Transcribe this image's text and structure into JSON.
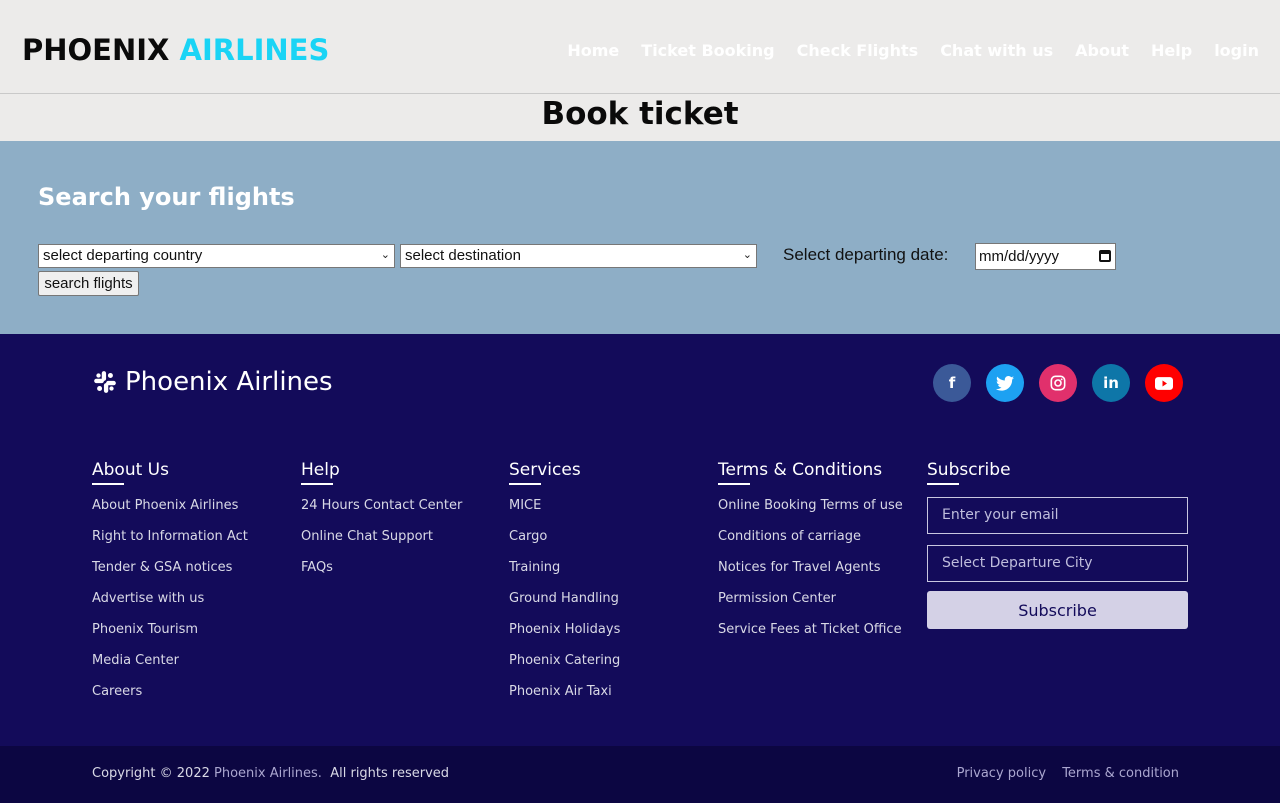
{
  "header": {
    "logo_part1": "PHOENIX",
    "logo_part2": "AIRLINES",
    "nav": [
      "Home",
      "Ticket Booking",
      "Check Flights",
      "Chat with us",
      "About",
      "Help",
      "login"
    ]
  },
  "page_title": "Book ticket",
  "search": {
    "title": "Search your flights",
    "departing_placeholder": "select departing country",
    "destination_placeholder": "select destination",
    "date_label": "Select departing date:",
    "date_placeholder": "mm/dd/yyyy",
    "button": "search flights"
  },
  "footer": {
    "brand": "Phoenix Airlines",
    "socials": [
      {
        "icon": "facebook-icon",
        "glyph": "f",
        "color": "#3b5998"
      },
      {
        "icon": "twitter-icon",
        "glyph": "t",
        "color": "#1da1f2"
      },
      {
        "icon": "instagram-icon",
        "glyph": "◎",
        "color": "#e1306c"
      },
      {
        "icon": "linkedin-icon",
        "glyph": "in",
        "color": "#0e76a8"
      },
      {
        "icon": "youtube-icon",
        "glyph": "▶",
        "color": "#ff0000"
      }
    ],
    "columns": [
      {
        "title": "About Us",
        "links": [
          "About Phoenix Airlines",
          "Right to Information Act",
          "Tender & GSA notices",
          "Advertise with us",
          "Phoenix Tourism",
          "Media Center",
          "Careers"
        ]
      },
      {
        "title": "Help",
        "links": [
          "24 Hours Contact Center",
          "Online Chat Support",
          "FAQs"
        ]
      },
      {
        "title": "Services",
        "links": [
          "MICE",
          "Cargo",
          "Training",
          "Ground Handling",
          "Phoenix Holidays",
          "Phoenix Catering",
          "Phoenix Air Taxi"
        ]
      },
      {
        "title": "Terms & Conditions",
        "links": [
          "Online Booking Terms of use",
          "Conditions of carriage",
          "Notices for Travel Agents",
          "Permission Center",
          "Service Fees at Ticket Office"
        ]
      }
    ],
    "subscribe": {
      "title": "Subscribe",
      "email_placeholder": "Enter your email",
      "city_placeholder": "Select Departure City",
      "button": "Subscribe"
    },
    "copyright_prefix": "Copyright © 2022",
    "copyright_brand": "Phoenix Airlines.",
    "copyright_suffix": "All rights reserved",
    "legal": [
      "Privacy policy",
      "Terms & condition"
    ]
  },
  "colors": {
    "accent": "#1ad4f5",
    "search_band": "#8eaec6",
    "footer_bg": "#130b5a",
    "bottom_bar": "#0c0642"
  }
}
